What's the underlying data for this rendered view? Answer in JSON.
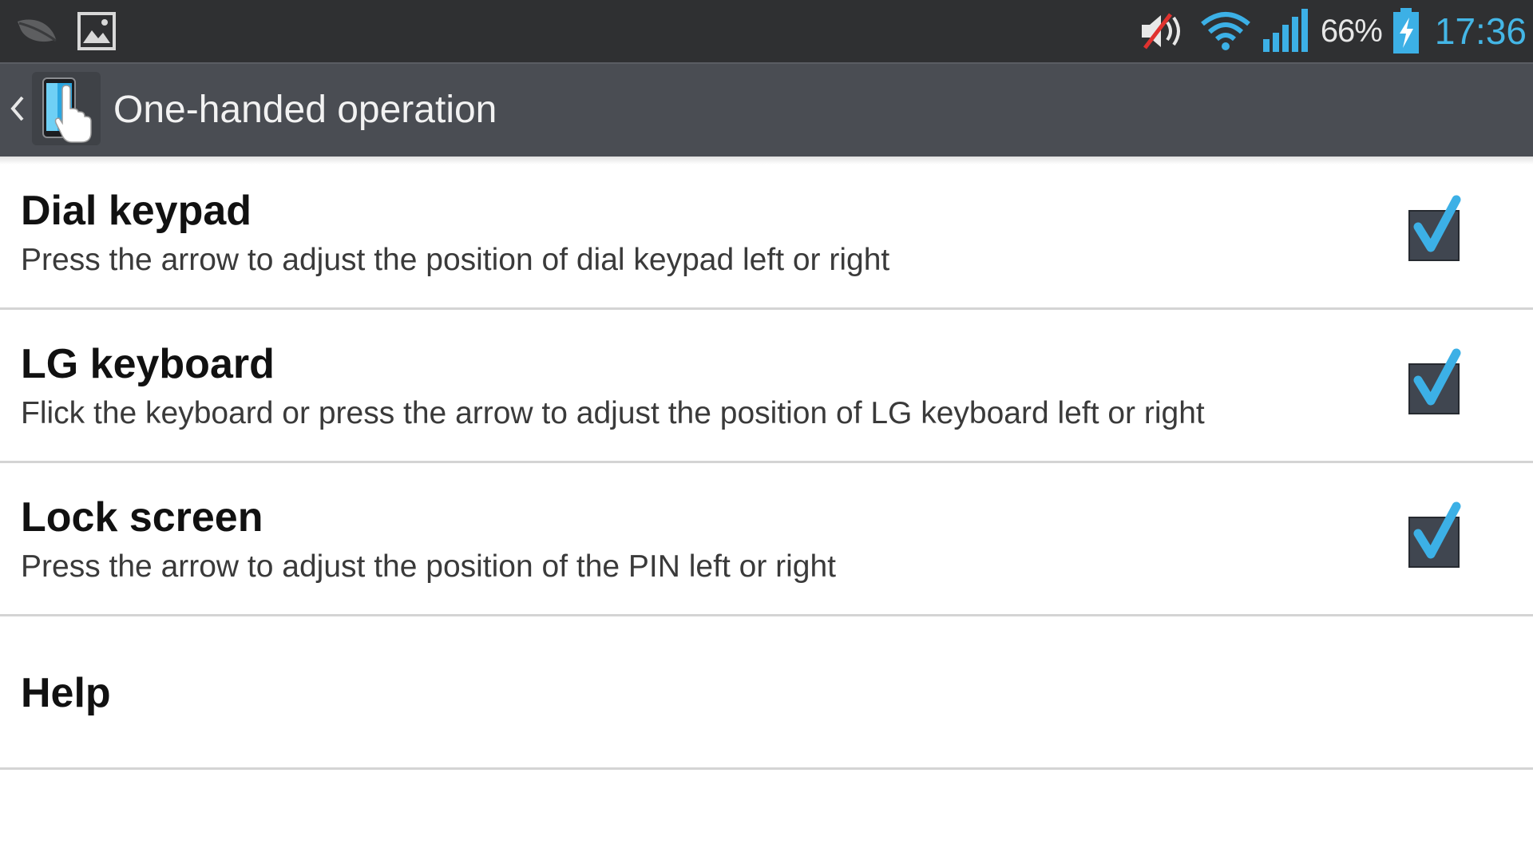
{
  "status_bar": {
    "icons_left": [
      "leaf-notification-icon",
      "image-notification-icon"
    ],
    "icons_right": [
      "muted-volume-icon",
      "wifi-icon",
      "cell-signal-icon",
      "battery-charging-icon"
    ],
    "battery_percent": "66%",
    "time": "17:36",
    "clock_color": "#44b6e6"
  },
  "action_bar": {
    "title": "One-handed operation",
    "icon": "one-handed-app-icon",
    "back_icon": "chevron-left-icon"
  },
  "settings": [
    {
      "title": "Dial keypad",
      "summary": "Press the arrow to adjust the position of dial keypad left or right",
      "checked": true
    },
    {
      "title": "LG keyboard",
      "summary": "Flick the keyboard or press the arrow to adjust the position of LG keyboard left or right",
      "checked": true
    },
    {
      "title": "Lock screen",
      "summary": "Press the arrow to adjust the position of the PIN left or right",
      "checked": true
    },
    {
      "title": "Help"
    }
  ],
  "colors": {
    "accent": "#3cb0e6",
    "status_bar_bg": "#2f3032",
    "action_bar_bg": "#4a4d53",
    "checkbox_fill": "#404650"
  }
}
